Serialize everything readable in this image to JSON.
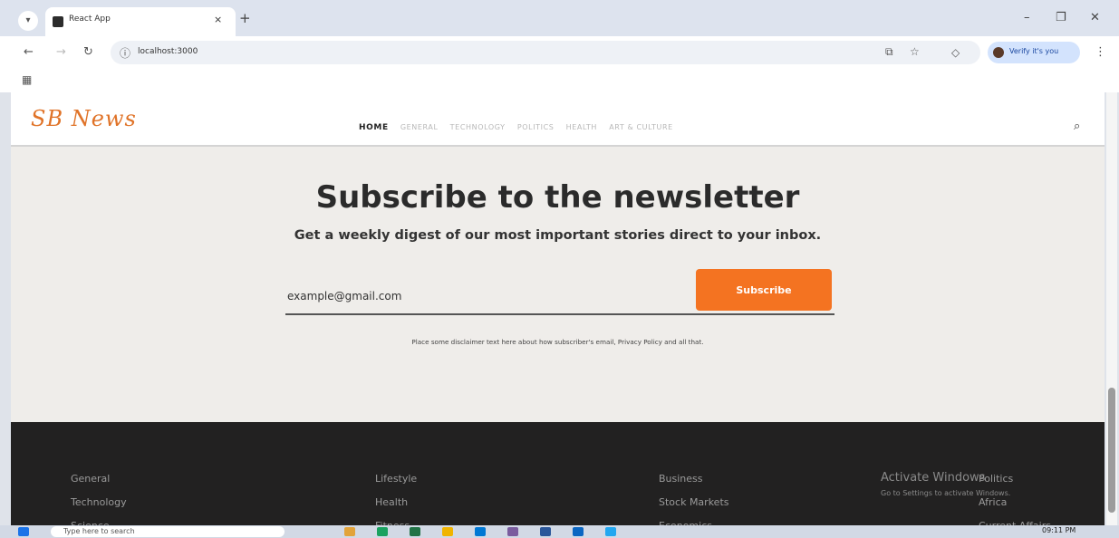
{
  "browser": {
    "tab_title": "React App",
    "tab_close": "×",
    "new_tab": "+",
    "url": "localhost:3000",
    "profile_label": "Verify it's you",
    "window_minimize": "–",
    "window_maximize": "❐",
    "window_close": "✕"
  },
  "site": {
    "logo": "SB News",
    "nav_items": [
      "HOME",
      "GENERAL",
      "TECHNOLOGY",
      "POLITICS",
      "HEALTH",
      "ART & CULTURE"
    ]
  },
  "newsletter": {
    "title": "Subscribe to the newsletter",
    "subtitle": "Get a weekly digest of our most important stories direct to your inbox.",
    "email_value": "example@gmail.com",
    "subscribe_label": "Subscribe",
    "disclaimer": "Place some disclaimer text here about how subscriber's email, Privacy Policy and all that."
  },
  "footer": {
    "col1": [
      "General",
      "Technology",
      "Science"
    ],
    "col2": [
      "Lifestyle",
      "Health",
      "Fitness"
    ],
    "col3": [
      "Business",
      "Stock Markets",
      "Economics"
    ],
    "col4": [
      "Politics",
      "Africa",
      "Current Affairs"
    ]
  },
  "os": {
    "activate_title": "Activate Windows",
    "activate_sub": "Go to Settings to activate Windows.",
    "search_placeholder": "Type here to search",
    "clock": "09:11 PM"
  }
}
